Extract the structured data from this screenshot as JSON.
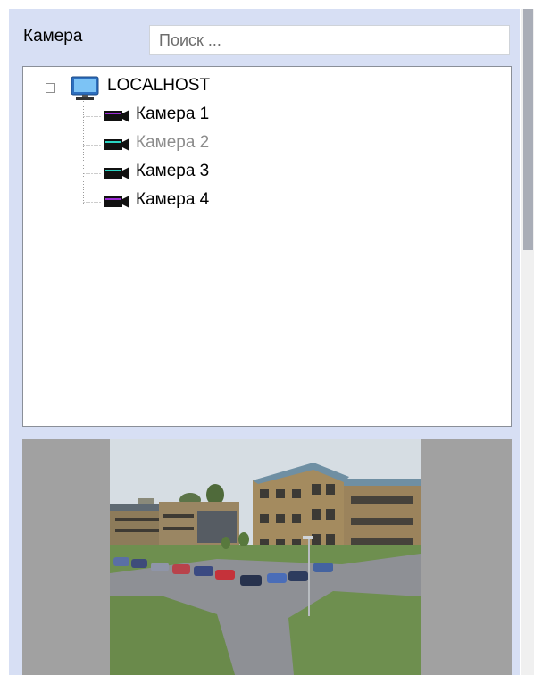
{
  "filter": {
    "label": "Камера",
    "search_placeholder": "Поиск ..."
  },
  "tree": {
    "host": {
      "label": "LOCALHOST",
      "icon": "monitor-icon",
      "expanded": true
    },
    "cameras": [
      {
        "label": "Камера 1",
        "enabled": true,
        "icon": "camera-icon"
      },
      {
        "label": "Камера 2",
        "enabled": false,
        "icon": "camera-icon"
      },
      {
        "label": "Камера 3",
        "enabled": true,
        "icon": "camera-icon"
      },
      {
        "label": "Камера 4",
        "enabled": true,
        "icon": "camera-icon"
      }
    ]
  },
  "preview": {
    "description_icon": "camera-preview-image"
  },
  "colors": {
    "panel_bg": "#d7dff4",
    "disabled_text": "#8c8c8c",
    "preview_bg": "#a1a1a1"
  }
}
